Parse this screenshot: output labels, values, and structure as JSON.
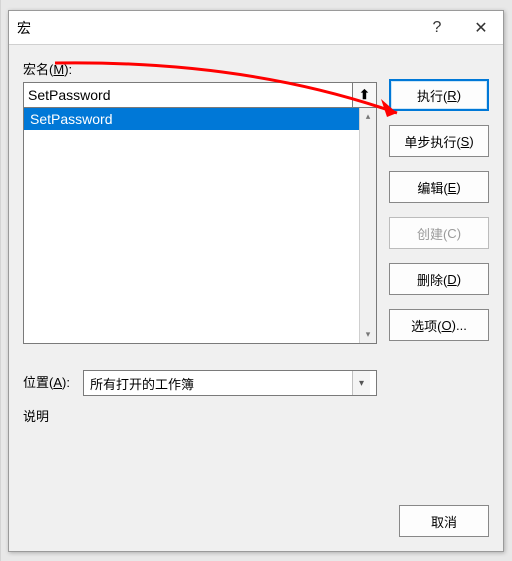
{
  "titlebar": {
    "title": "宏",
    "help": "?",
    "close": "✕"
  },
  "labels": {
    "macro_name_prefix": "宏名(",
    "macro_name_accel": "M",
    "macro_name_suffix": "):",
    "location_prefix": "位置(",
    "location_accel": "A",
    "location_suffix": "):",
    "description": "说明"
  },
  "inputs": {
    "macro_name_value": "SetPassword",
    "location_value": "所有打开的工作簿"
  },
  "list": {
    "items": [
      "SetPassword"
    ],
    "selected_index": 0
  },
  "buttons": {
    "run_prefix": "执行(",
    "run_accel": "R",
    "run_suffix": ")",
    "step_prefix": "单步执行(",
    "step_accel": "S",
    "step_suffix": ")",
    "edit_prefix": "编辑(",
    "edit_accel": "E",
    "edit_suffix": ")",
    "create_prefix": "创建(",
    "create_accel": "C",
    "create_suffix": ")",
    "delete_prefix": "删除(",
    "delete_accel": "D",
    "delete_suffix": ")",
    "options_prefix": "选项(",
    "options_accel": "O",
    "options_suffix": ")...",
    "cancel": "取消"
  },
  "icons": {
    "up_arrow": "⬆",
    "chevron_down": "▾",
    "scroll_up": "▴",
    "scroll_down": "▾"
  }
}
